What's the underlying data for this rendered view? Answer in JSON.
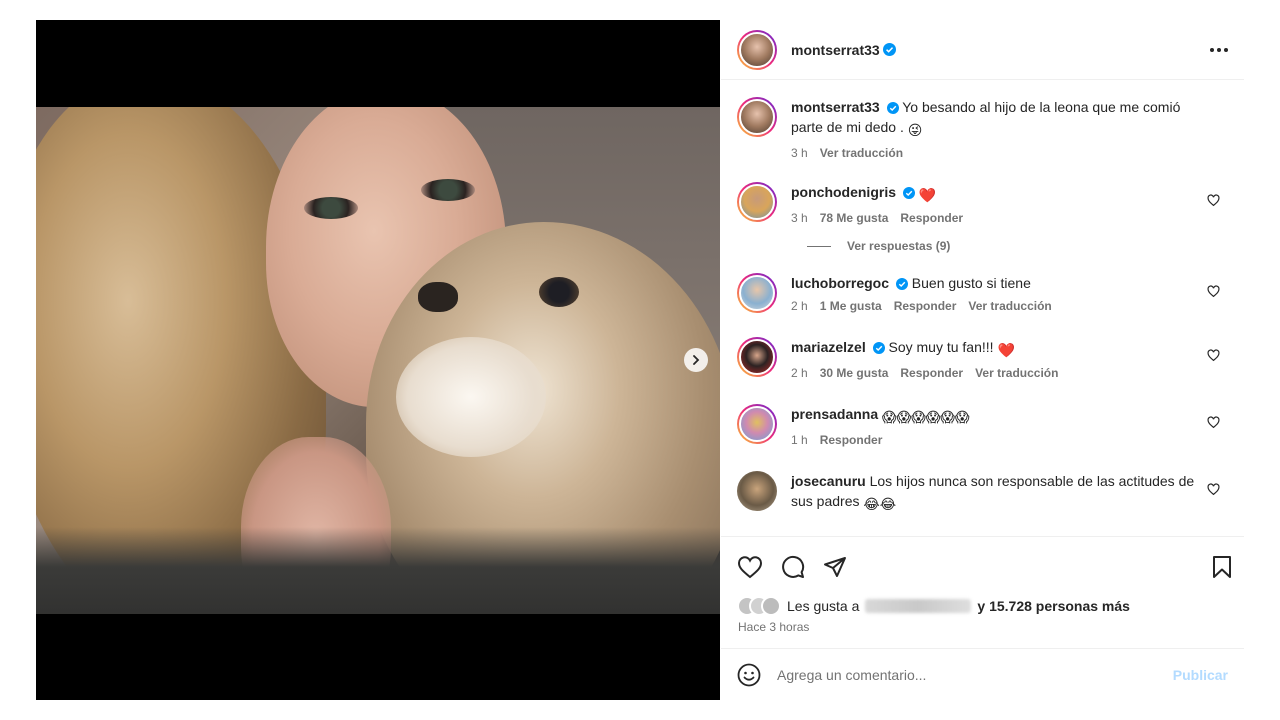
{
  "post": {
    "author": "montserrat33",
    "caption": "Yo besando al hijo de la leona que me comió parte de mi dedo .",
    "caption_time": "3 h",
    "caption_translate": "Ver traducción",
    "carousel": {
      "current": 1,
      "total": 2
    }
  },
  "icons": {
    "verified": "verified-badge-icon",
    "more": "more-options-icon",
    "like": "heart-icon",
    "comment": "comment-icon",
    "share": "send-icon",
    "save": "bookmark-icon",
    "emoji": "emoji-icon",
    "next": "chevron-right-icon"
  },
  "colors": {
    "verified": "#0095f6",
    "heart": "#ed4956",
    "publish": "#b3dbff",
    "muted": "#737373"
  },
  "comments": [
    {
      "user": "ponchodenigris",
      "text": "",
      "emoji": "❤️",
      "time": "3 h",
      "likes": "78 Me gusta",
      "reply": "Responder",
      "view_replies": "Ver respuestas (9)"
    },
    {
      "user": "luchoborregoc",
      "text": "Buen gusto si tiene",
      "time": "2 h",
      "likes": "1 Me gusta",
      "reply": "Responder",
      "translate": "Ver traducción"
    },
    {
      "user": "mariazelzel",
      "text": "Soy muy tu fan!!!",
      "emoji": "❤️",
      "time": "2 h",
      "likes": "30 Me gusta",
      "reply": "Responder",
      "translate": "Ver traducción"
    },
    {
      "user": "prensadanna",
      "text": "",
      "emoji": "😱😱😱😱😱😱",
      "time": "1 h",
      "reply": "Responder"
    },
    {
      "user": "josecanuru",
      "text": "Los hijos nunca son responsable de las actitudes de sus padres",
      "emoji": "😂😂"
    }
  ],
  "likes": {
    "prefix": "Les gusta a",
    "suffix": "y 15.728 personas más"
  },
  "posted": "Hace 3 horas",
  "composer": {
    "placeholder": "Agrega un comentario...",
    "publish": "Publicar"
  }
}
